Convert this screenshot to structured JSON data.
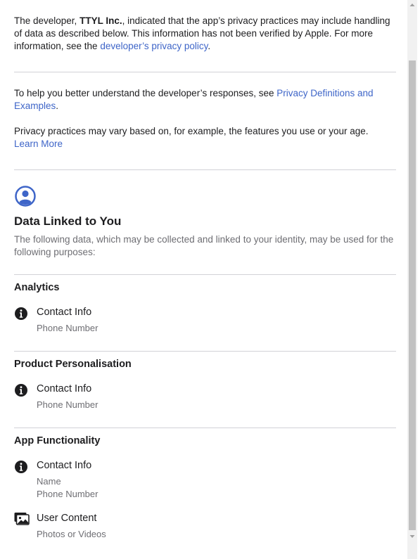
{
  "intro": {
    "prefix": "The developer, ",
    "developer": "TTYL Inc.",
    "middle": ", indicated that the app’s privacy practices may include handling of data as described below. This information has not been verified by Apple. For more information, see the ",
    "policy_link": "developer’s privacy policy",
    "suffix": "."
  },
  "help": {
    "text": "To help you better understand the developer’s responses, see ",
    "link": "Privacy Definitions and Examples",
    "suffix": "."
  },
  "practices": {
    "text": "Privacy practices may vary based on, for example, the features you use or your age.",
    "learn_more": "Learn More"
  },
  "linked": {
    "title": "Data Linked to You",
    "description": "The following data, which may be collected and linked to your identity, may be used for the following purposes:"
  },
  "sections": [
    {
      "title": "Analytics",
      "items": [
        {
          "icon": "info-icon",
          "title": "Contact Info",
          "subs": [
            "Phone Number"
          ]
        }
      ]
    },
    {
      "title": "Product Personalisation",
      "items": [
        {
          "icon": "info-icon",
          "title": "Contact Info",
          "subs": [
            "Phone Number"
          ]
        }
      ]
    },
    {
      "title": "App Functionality",
      "items": [
        {
          "icon": "info-icon",
          "title": "Contact Info",
          "subs": [
            "Name",
            "Phone Number"
          ]
        },
        {
          "icon": "photos-icon",
          "title": "User Content",
          "subs": [
            "Photos or Videos"
          ]
        }
      ]
    }
  ],
  "colors": {
    "accent": "#3e65c8",
    "text": "#1d1d1f",
    "muted": "#6e6e73",
    "divider": "#d2d2d7"
  }
}
